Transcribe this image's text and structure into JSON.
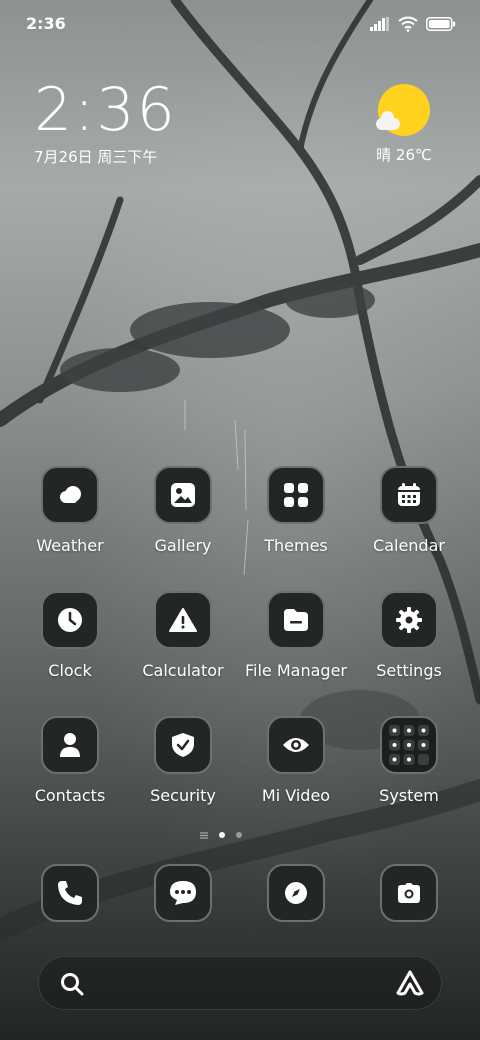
{
  "status_bar": {
    "time": "2:36",
    "icons": [
      "signal-icon",
      "wifi-icon",
      "battery-icon"
    ]
  },
  "clock_widget": {
    "time": "2:36",
    "date": "7月26日 周三下午"
  },
  "weather_widget": {
    "icon": "sun-cloud-icon",
    "text": "晴 26℃"
  },
  "apps": [
    {
      "label": "Weather",
      "icon": "cloud-icon"
    },
    {
      "label": "Gallery",
      "icon": "image-icon"
    },
    {
      "label": "Themes",
      "icon": "grid-icon"
    },
    {
      "label": "Calendar",
      "icon": "calendar-icon"
    },
    {
      "label": "Clock",
      "icon": "clock-icon"
    },
    {
      "label": "Calculator",
      "icon": "warning-icon"
    },
    {
      "label": "File Manager",
      "icon": "folder-icon"
    },
    {
      "label": "Settings",
      "icon": "gear-icon"
    },
    {
      "label": "Contacts",
      "icon": "person-icon"
    },
    {
      "label": "Security",
      "icon": "shield-icon"
    },
    {
      "label": "Mi Video",
      "icon": "eye-icon"
    },
    {
      "label": "System",
      "icon": "folder-grid-icon"
    }
  ],
  "page_indicator": {
    "pages": 2,
    "current": 1
  },
  "dock": [
    {
      "icon": "phone-icon"
    },
    {
      "icon": "message-icon"
    },
    {
      "icon": "compass-icon"
    },
    {
      "icon": "camera-icon"
    }
  ],
  "search_bar": {
    "left_icon": "search-icon",
    "right_icon": "assistant-icon"
  },
  "colors": {
    "tile_bg": "#222625",
    "tile_border": "#6c7170",
    "sun": "#ffd21e"
  }
}
